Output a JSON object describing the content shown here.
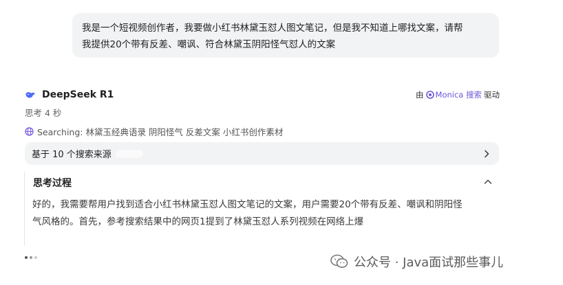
{
  "user_message": {
    "line1": "我是一个短视频创作者，我要做小红书林黛玉怼人图文笔记，但是我不知道上哪找文案，请帮",
    "line2": "我提供20个带有反差、嘲讽、符合林黛玉阴阳怪气怼人的文案"
  },
  "response": {
    "model_name": "DeepSeek R1",
    "powered_by_prefix": "由",
    "powered_by_link": "Monica 搜索",
    "powered_by_suffix": "驱动",
    "think_time": "思考 4 秒",
    "searching_text": "Searching: 林黛玉经典语录 阴阳怪气 反差文案 小红书创作素材",
    "sources_label": "基于 10 个搜索来源",
    "thinking": {
      "title": "思考过程",
      "line1": "好的，我需要帮用户找到适合小红书林黛玉怼人图文笔记的文案，用户需要20个带有反差、嘲讽和阴阳怪",
      "line2": "气风格的。首先，参考搜索结果中的网页1提到了林黛玉怼人系列视频在网络上爆"
    }
  },
  "watermark": {
    "text": "公众号 · Java面试那些事儿"
  },
  "icons": {
    "model_logo": "deepseek-whale-icon",
    "monica": "monica-icon",
    "globe": "globe-icon",
    "chevron_right": "chevron-right-icon",
    "chevron_up": "chevron-up-icon",
    "wechat": "wechat-icon"
  },
  "colors": {
    "accent": "#6b57d8",
    "bubble_bg": "#f2f3f5",
    "deepseek_blue": "#4d6bfe"
  }
}
